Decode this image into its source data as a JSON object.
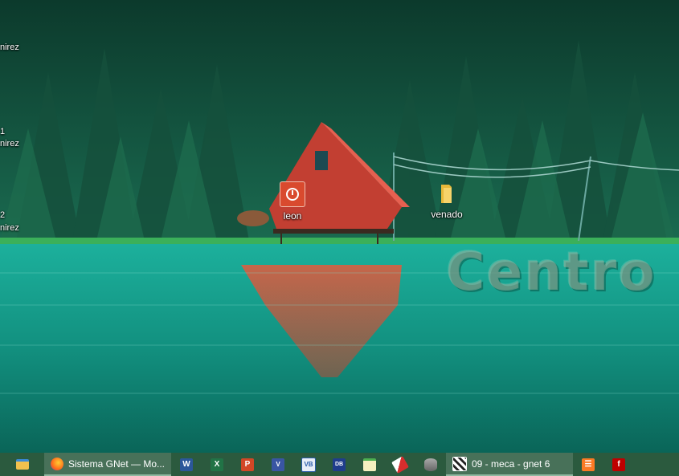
{
  "desktop": {
    "left_cut_labels": [
      "nirez",
      "1",
      "nirez",
      "2",
      "nirez"
    ],
    "icons": [
      {
        "label": "leon",
        "icon": "power-icon"
      },
      {
        "label": "venado",
        "icon": "folder-icon"
      }
    ],
    "watermark": "Centro"
  },
  "taskbar": {
    "firefox_title": "Sistema GNet — Mo...",
    "gnet_title": "09 - meca - gnet 6",
    "pinned": [
      "file-explorer-icon",
      "firefox-icon",
      "word-icon",
      "excel-icon",
      "powerpoint-icon",
      "visio-icon",
      "vb-icon",
      "access-icon",
      "notepad-icon",
      "eraser-icon",
      "database-icon",
      "gnet-icon",
      "xampp-icon",
      "filezilla-icon"
    ]
  },
  "colors": {
    "taskbar": "#2b5a3e",
    "house": "#d6473a",
    "water": "#15a08e"
  }
}
